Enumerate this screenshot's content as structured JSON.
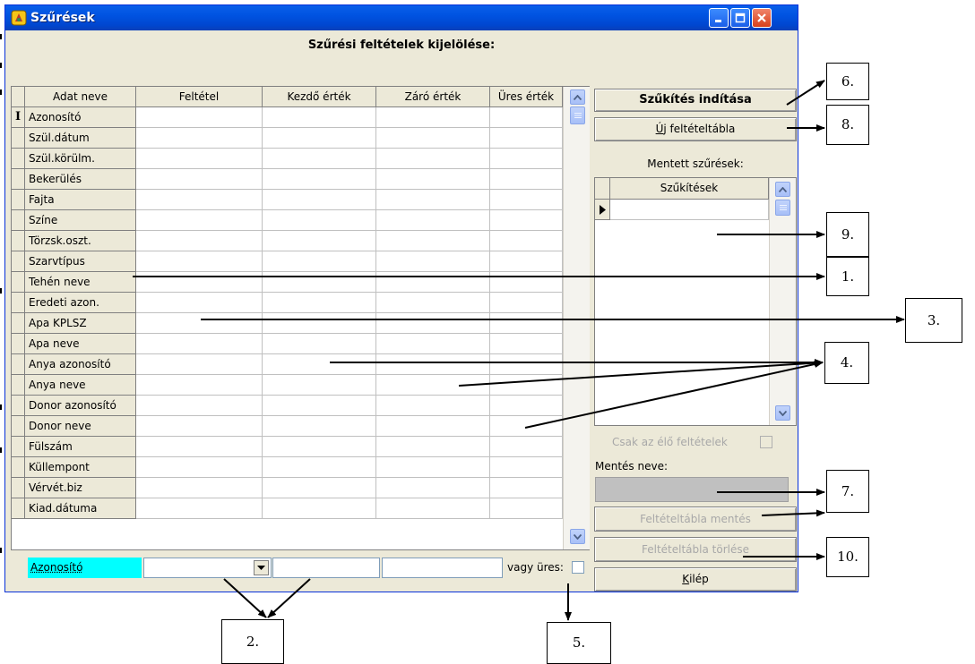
{
  "window": {
    "title": "Szűrések",
    "heading": "Szűrési feltételek kijelölése:"
  },
  "grid": {
    "columns": [
      "Adat neve",
      "Feltétel",
      "Kezdő érték",
      "Záró érték",
      "Üres érték"
    ],
    "current_row_marker": "I",
    "rows": [
      "Azonosító",
      "Szül.dátum",
      "Szül.körülm.",
      "Bekerülés",
      "Fajta",
      "Színe",
      "Törzsk.oszt.",
      "Szarvtípus",
      "Tehén neve",
      "Eredeti azon.",
      "Apa KPLSZ",
      "Apa neve",
      "Anya azonosító",
      "Anya neve",
      "Donor azonosító",
      "Donor neve",
      "Fülszám",
      "Küllempont",
      "Vérvét.biz",
      "Kiad.dátuma"
    ]
  },
  "editor": {
    "field_value": "Azonosító",
    "condition_value": "",
    "start_value": "",
    "end_value": "",
    "empty_label": "vagy üres:"
  },
  "panel": {
    "start_button": "Szűkítés indítása",
    "new_table_button": "Új feltételtábla",
    "saved_label": "Mentett szűrések:",
    "saved_column": "Szűkítések",
    "only_live_label": "Csak az élő feltételek",
    "save_name_label": "Mentés neve:",
    "save_name_value": "",
    "save_table_button": "Feltételtábla mentés",
    "delete_table_button": "Feltételtábla törlése",
    "exit_button": "Kilép"
  },
  "callouts": [
    "1.",
    "2.",
    "3.",
    "4.",
    "5.",
    "6.",
    "7.",
    "8.",
    "9.",
    "10."
  ],
  "colors": {
    "titlebar": "#0053e1",
    "window_bg": "#ece9d8",
    "selected_field_bg": "#00ffff",
    "save_name_bg": "#c0c0c0"
  },
  "icons": [
    "app-icon",
    "minimize-icon",
    "maximize-icon",
    "close-icon",
    "scroll-up-icon",
    "scroll-down-icon",
    "dropdown-arrow-icon",
    "row-pointer-icon"
  ]
}
